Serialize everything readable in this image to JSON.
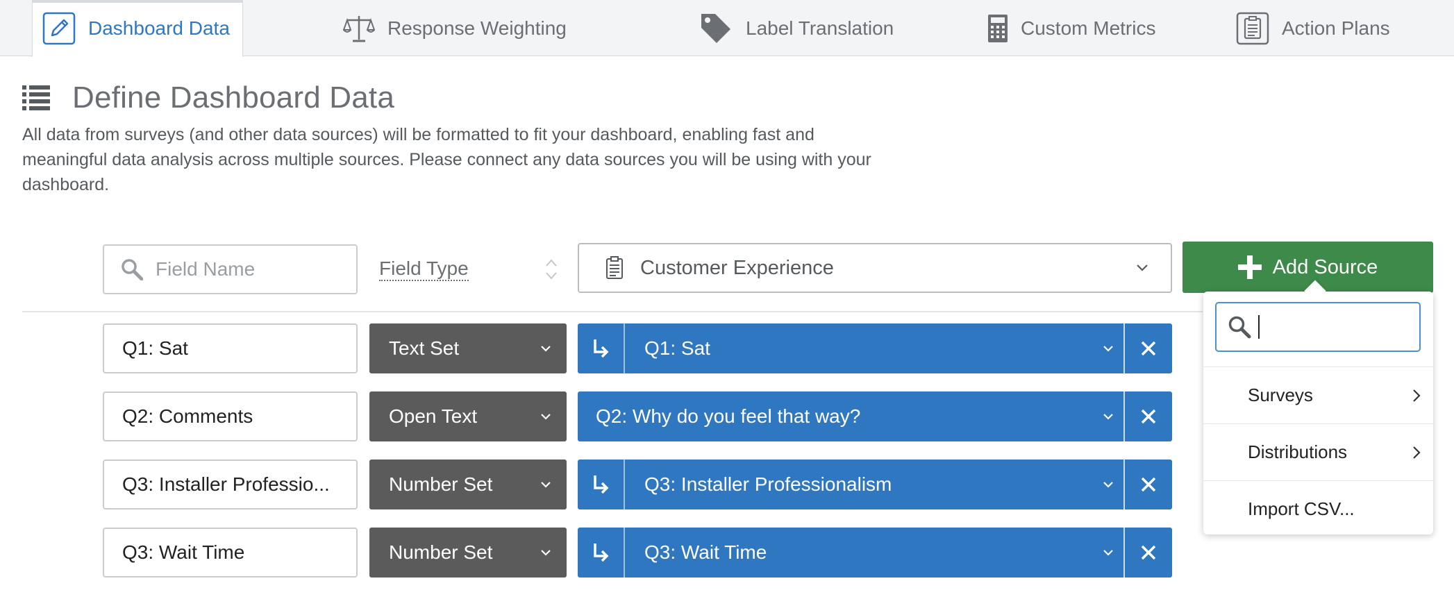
{
  "tabs": [
    {
      "label": "Dashboard Data",
      "icon": "pencil-icon",
      "active": true
    },
    {
      "label": "Response Weighting",
      "icon": "scale-icon",
      "active": false
    },
    {
      "label": "Label Translation",
      "icon": "tag-icon",
      "active": false
    },
    {
      "label": "Custom Metrics",
      "icon": "calculator-icon",
      "active": false
    },
    {
      "label": "Action Plans",
      "icon": "clipboard-icon",
      "active": false
    }
  ],
  "page": {
    "title": "Define Dashboard Data",
    "description": "All data from surveys (and other data sources) will be formatted to fit your dashboard, enabling fast and meaningful data analysis across multiple sources. Please connect any data sources you will be using with your dashboard."
  },
  "filters": {
    "field_name_placeholder": "Field Name",
    "field_type_label": "Field Type",
    "source_selected": "Customer Experience",
    "add_source_label": "Add Source"
  },
  "rows": [
    {
      "field_name": "Q1: Sat",
      "field_type": "Text Set",
      "mapped_to": "Q1: Sat",
      "has_arrow": true
    },
    {
      "field_name": "Q2: Comments",
      "field_type": "Open Text",
      "mapped_to": "Q2: Why do you feel that way?",
      "has_arrow": false
    },
    {
      "field_name": "Q3: Installer Professio...",
      "field_type": "Number Set",
      "mapped_to": "Q3: Installer Professionalism",
      "has_arrow": true
    },
    {
      "field_name": "Q3: Wait Time",
      "field_type": "Number Set",
      "mapped_to": "Q3: Wait Time",
      "has_arrow": true
    }
  ],
  "add_source_menu": {
    "search_value": "",
    "items": [
      "Surveys",
      "Distributions",
      "Import CSV..."
    ]
  },
  "colors": {
    "accent_blue": "#2f77c0",
    "add_green": "#3e8a4a",
    "type_gray": "#5b5b5b",
    "tab_bar_bg": "#f3f4f6"
  }
}
